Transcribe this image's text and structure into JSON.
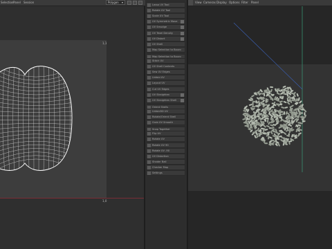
{
  "top_menu": {
    "items": [
      "Selection",
      "Panel",
      "Session"
    ],
    "mode_dropdown": "Polygon"
  },
  "uv_editor": {
    "corner_top_right": "1,1",
    "corner_bottom_right": "1,0"
  },
  "tool_panel": {
    "items": [
      {
        "label": "Lasso UV Tool",
        "right_icon": false
      },
      {
        "label": "Rotate UV Tool",
        "right_icon": false
      },
      {
        "label": "Scale UV Tool",
        "right_icon": false
      },
      {
        "label": "UV Symmetric Move",
        "right_icon": true
      },
      {
        "label": "UV Smudge",
        "right_icon": true
      },
      {
        "label": "UV Texel Density",
        "right_icon": true
      },
      {
        "label": "UV Distort",
        "right_icon": true
      },
      {
        "label": "UV Shell",
        "right_icon": false
      },
      {
        "label": "Map Selection to Bounding",
        "right_icon": false
      },
      {
        "label": "Map Selection to Bounding",
        "right_icon": false
      },
      {
        "label": "Stitch UV",
        "right_icon": false
      },
      {
        "label": "UV Shell Contents",
        "right_icon": false
      },
      {
        "label": "Sew UV Edges",
        "right_icon": false
      },
      {
        "label": "Unfold UV",
        "right_icon": false
      },
      {
        "label": "Layout UV",
        "right_icon": false
      },
      {
        "label": "Cut UV Edges",
        "right_icon": false
      },
      {
        "label": "UV Straighten",
        "right_icon": true
      },
      {
        "label": "UV Straighten Shell",
        "right_icon": true
      },
      {
        "label": "Orient Shells",
        "right_icon": false
      },
      {
        "label": "Unfold3D UV",
        "right_icon": false
      },
      {
        "label": "Rotate/Orient Shell",
        "right_icon": false
      },
      {
        "label": "Grab UV Smooth",
        "right_icon": false
      },
      {
        "label": "Snap Together",
        "right_icon": false
      },
      {
        "label": "Flip UV",
        "right_icon": false
      },
      {
        "label": "Rotate UV",
        "right_icon": false
      },
      {
        "label": "Rotate UV 90",
        "right_icon": false
      },
      {
        "label": "Rotate UV -90",
        "right_icon": false
      },
      {
        "label": "UV Distortion",
        "right_icon": false
      },
      {
        "label": "Shader Ball",
        "right_icon": false
      },
      {
        "label": "Checker Map",
        "right_icon": false
      },
      {
        "label": "Settings",
        "right_icon": false
      }
    ]
  },
  "viewport": {
    "menu": [
      "View",
      "Cameras",
      "Display",
      "Options",
      "Filter",
      "Panel"
    ]
  },
  "colors": {
    "uv_wire": "#e6e6e6",
    "axis_red": "#8a2f3a",
    "axis_green": "#3aa07a",
    "axis_blue": "#3a5fb0",
    "pill": "#bcc3b8"
  }
}
